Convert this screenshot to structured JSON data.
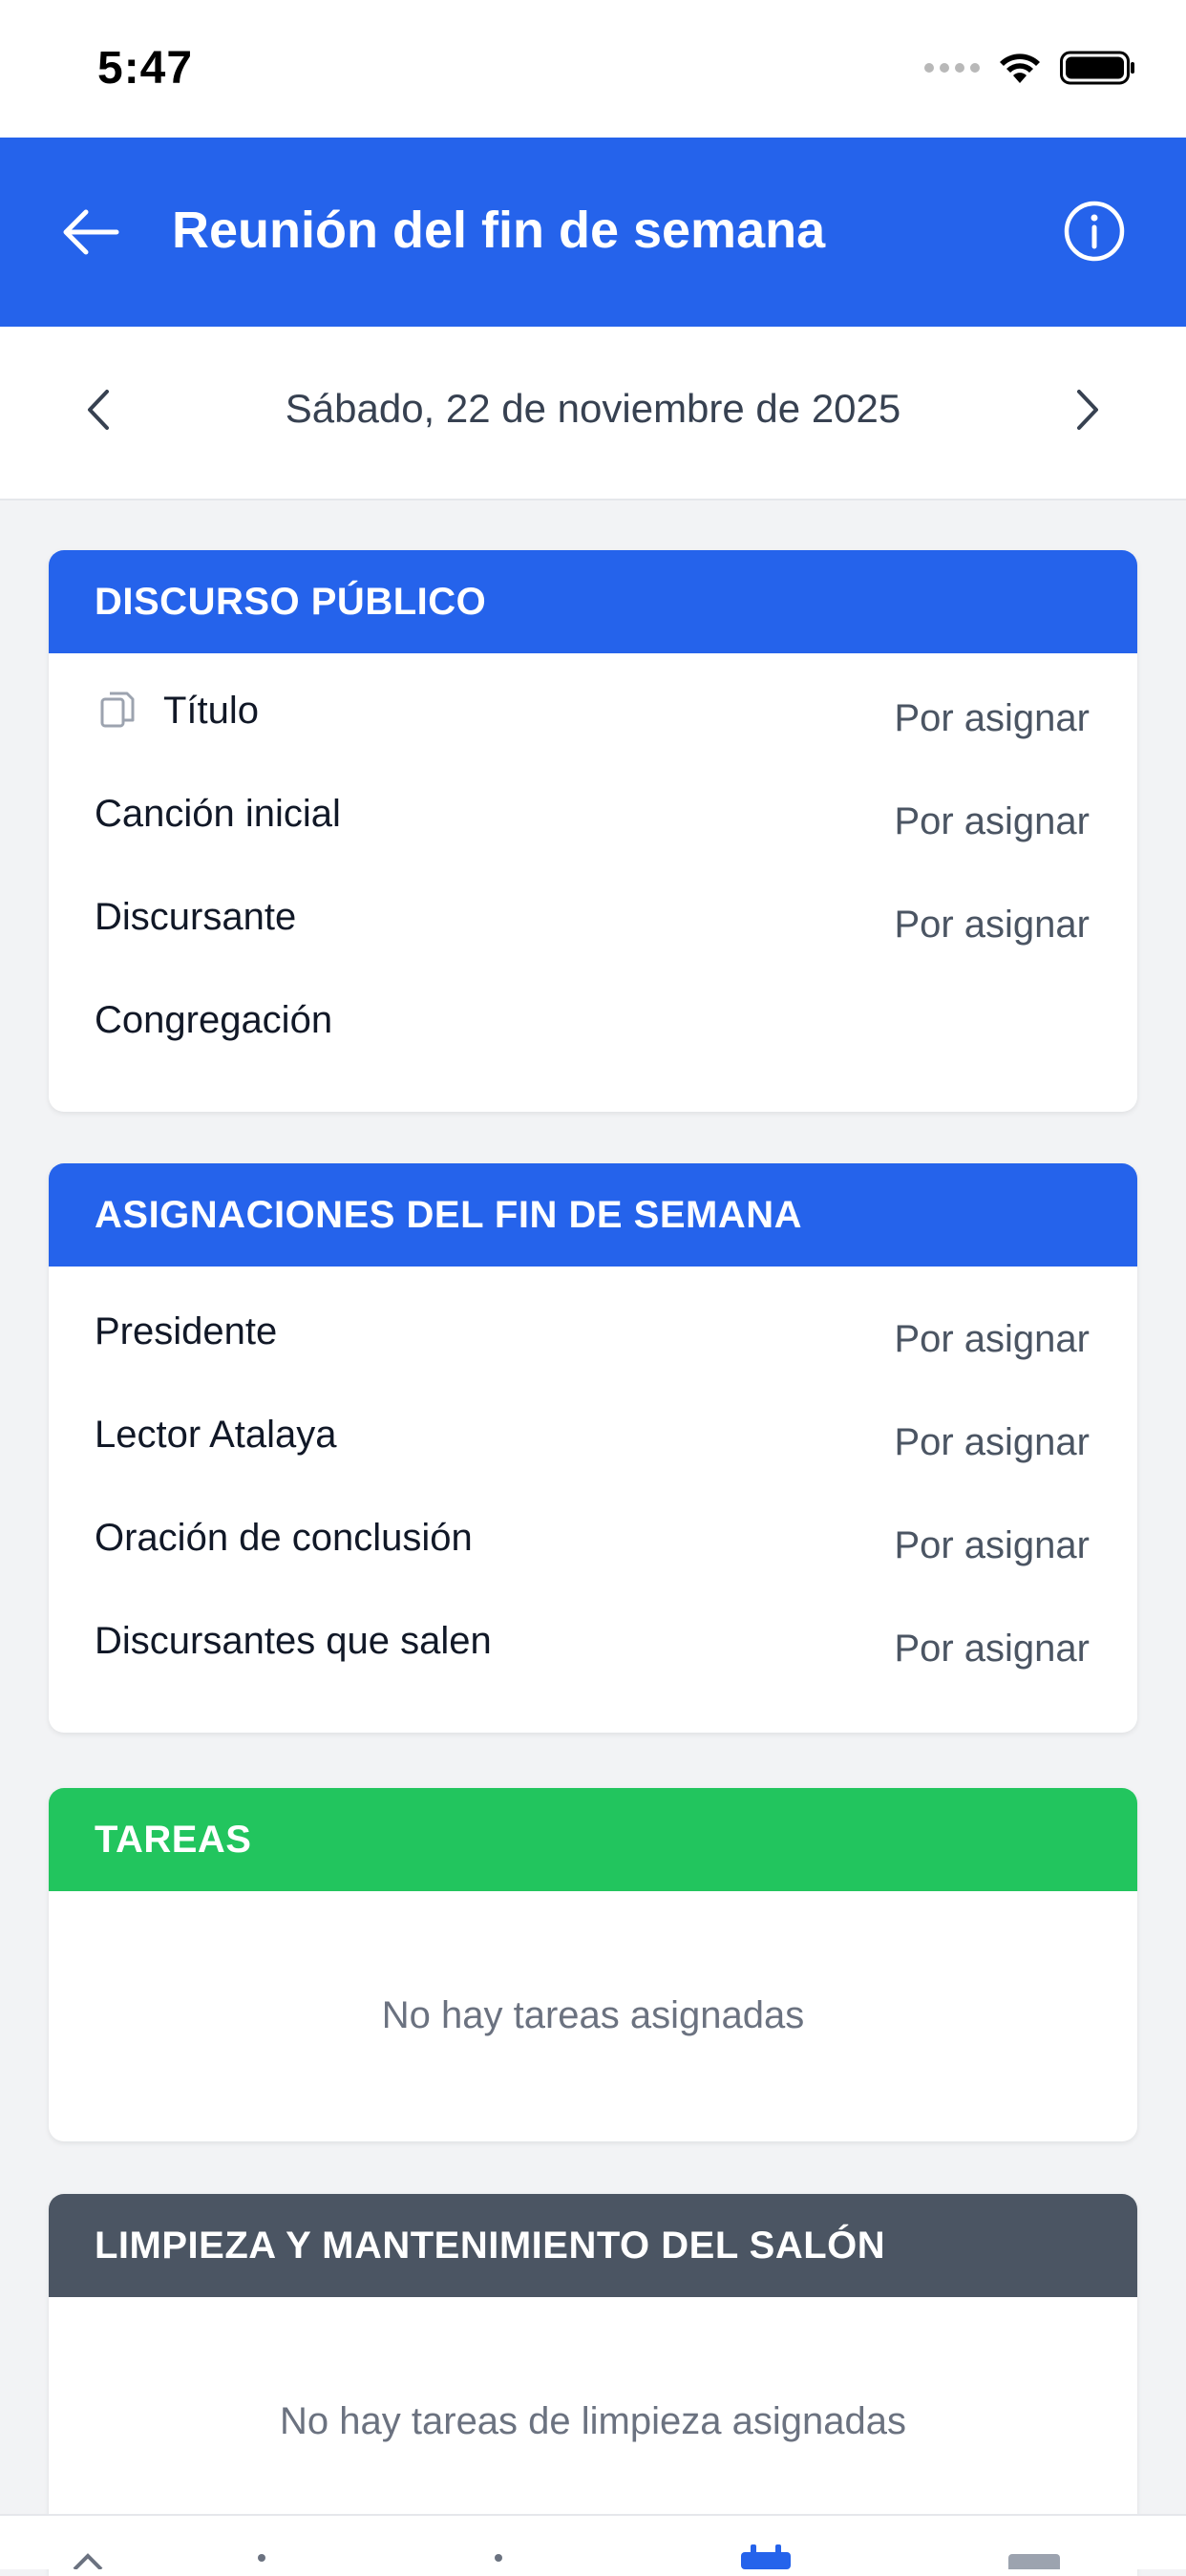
{
  "status_bar": {
    "time": "5:47"
  },
  "app_bar": {
    "title": "Reunión del fin de semana"
  },
  "date_nav": {
    "date": "Sábado, 22 de noviembre de 2025"
  },
  "colors": {
    "primary": "#2563eb",
    "success": "#22c55e",
    "slate": "#4b5563"
  },
  "sections": {
    "discurso": {
      "header": "DISCURSO PÚBLICO",
      "rows": [
        {
          "label": "Título",
          "value": "Por asignar"
        },
        {
          "label": "Canción inicial",
          "value": "Por asignar"
        },
        {
          "label": "Discursante",
          "value": "Por asignar"
        },
        {
          "label": "Congregación",
          "value": ""
        }
      ]
    },
    "asignaciones": {
      "header": "ASIGNACIONES DEL FIN DE SEMANA",
      "rows": [
        {
          "label": "Presidente",
          "value": "Por asignar"
        },
        {
          "label": "Lector Atalaya",
          "value": "Por asignar"
        },
        {
          "label": "Oración de conclusión",
          "value": "Por asignar"
        },
        {
          "label": "Discursantes que salen",
          "value": "Por asignar"
        }
      ]
    },
    "tareas": {
      "header": "TAREAS",
      "empty": "No hay tareas asignadas"
    },
    "limpieza": {
      "header": "LIMPIEZA Y MANTENIMIENTO DEL SALÓN",
      "empty": "No hay tareas de limpieza asignadas"
    }
  },
  "icons": [
    "back-arrow-icon",
    "info-icon",
    "chevron-left-icon",
    "chevron-right-icon",
    "copy-icon",
    "wifi-icon",
    "battery-icon",
    "home-icon",
    "calendar-icon"
  ]
}
